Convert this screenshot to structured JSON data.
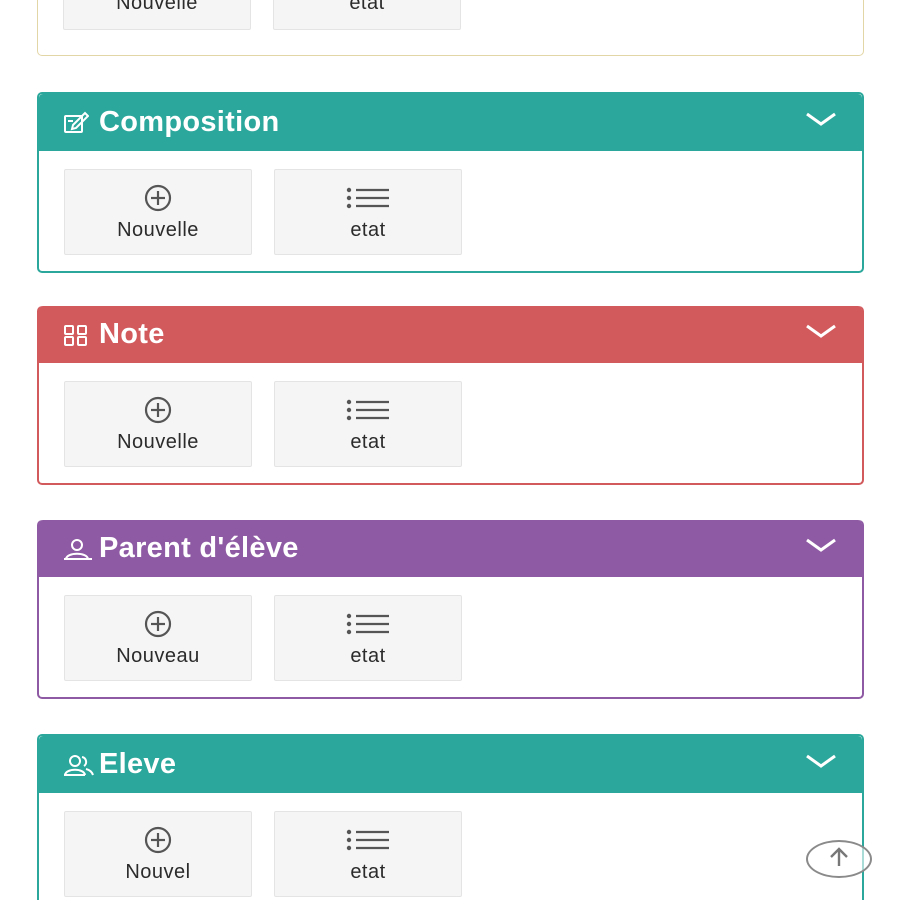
{
  "colors": {
    "teal": "#2ba79b",
    "red": "#d2595c",
    "purple": "#8e5aa3",
    "tile_bg": "#f5f5f5"
  },
  "panels": [
    {
      "title": "",
      "icon": "none",
      "new_label": "Nouvelle",
      "state_label": "etat"
    },
    {
      "title": "Composition",
      "icon": "edit-icon",
      "new_label": "Nouvelle",
      "state_label": "etat"
    },
    {
      "title": "Note",
      "icon": "grid-icon",
      "new_label": "Nouvelle",
      "state_label": "etat"
    },
    {
      "title": "Parent d'élève",
      "icon": "user-icon",
      "new_label": "Nouveau",
      "state_label": "etat"
    },
    {
      "title": "Eleve",
      "icon": "users-icon",
      "new_label": "Nouvel",
      "state_label": "etat"
    }
  ],
  "scroll_top_icon": "arrow-up-circle-icon"
}
